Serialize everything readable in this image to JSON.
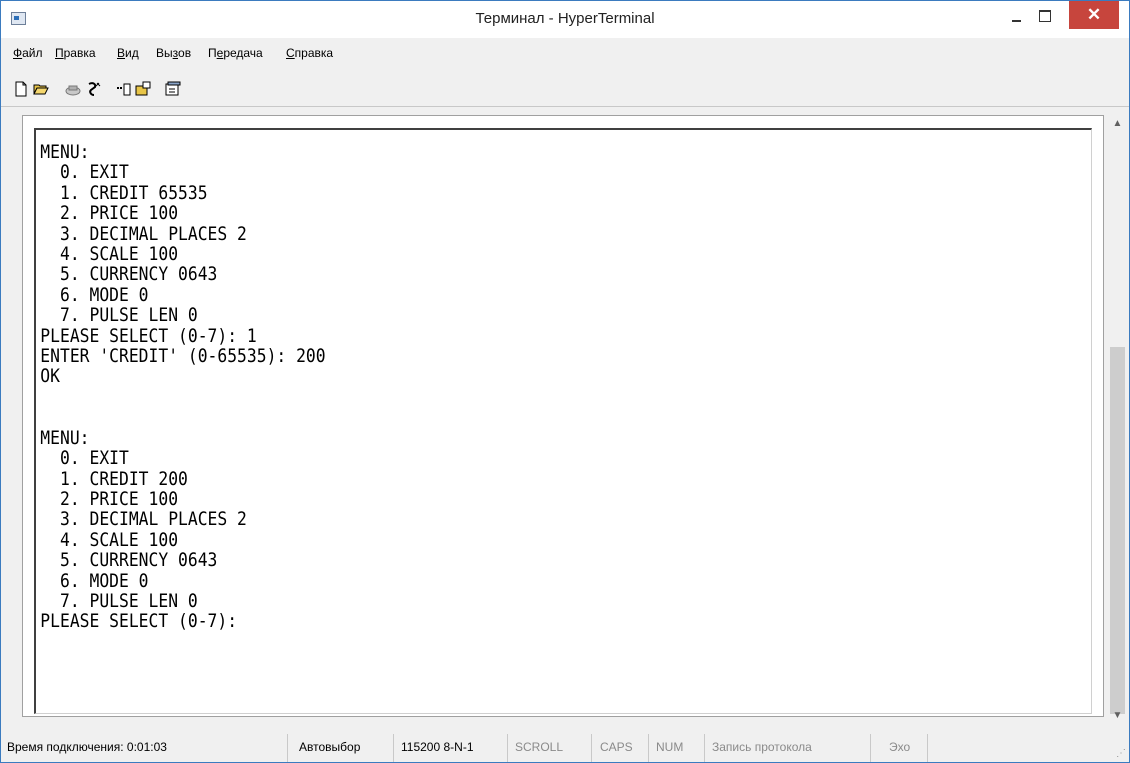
{
  "window": {
    "title": "Терминал - HyperTerminal"
  },
  "menu": [
    {
      "label": "Файл",
      "u": "Ф",
      "rest": "айл"
    },
    {
      "label": "Правка",
      "u": "П",
      "rest": "равка"
    },
    {
      "label": "Вид",
      "u": "В",
      "rest": "ид"
    },
    {
      "label": "Вызов",
      "pre": "Вы",
      "u": "з",
      "rest": "ов"
    },
    {
      "label": "Передача",
      "pre": "П",
      "u": "е",
      "rest": "редача"
    },
    {
      "label": "Справка",
      "u": "С",
      "rest": "правка"
    }
  ],
  "toolbar": [
    "new-icon",
    "open-icon",
    "call-icon",
    "disconnect-icon",
    "send-icon",
    "receive-icon",
    "properties-icon"
  ],
  "terminal": {
    "lines": [
      "MENU:",
      "  0. EXIT",
      "  1. CREDIT 65535",
      "  2. PRICE 100",
      "  3. DECIMAL PLACES 2",
      "  4. SCALE 100",
      "  5. CURRENCY 0643",
      "  6. MODE 0",
      "  7. PULSE LEN 0",
      "PLEASE SELECT (0-7): 1",
      "ENTER 'CREDIT' (0-65535): 200",
      "OK",
      "",
      "",
      "MENU:",
      "  0. EXIT",
      "  1. CREDIT 200",
      "  2. PRICE 100",
      "  3. DECIMAL PLACES 2",
      "  4. SCALE 100",
      "  5. CURRENCY 0643",
      "  6. MODE 0",
      "  7. PULSE LEN 0",
      "PLEASE SELECT (0-7):"
    ]
  },
  "status": {
    "connection_time": "Время подключения: 0:01:03",
    "autodetect": "Автовыбор",
    "port_settings": "115200 8-N-1",
    "scroll": "SCROLL",
    "caps": "CAPS",
    "num": "NUM",
    "capture": "Запись протокола",
    "echo": "Эхо"
  },
  "colors": {
    "close_button": "#c7453d",
    "window_border": "#3b7bbf"
  }
}
